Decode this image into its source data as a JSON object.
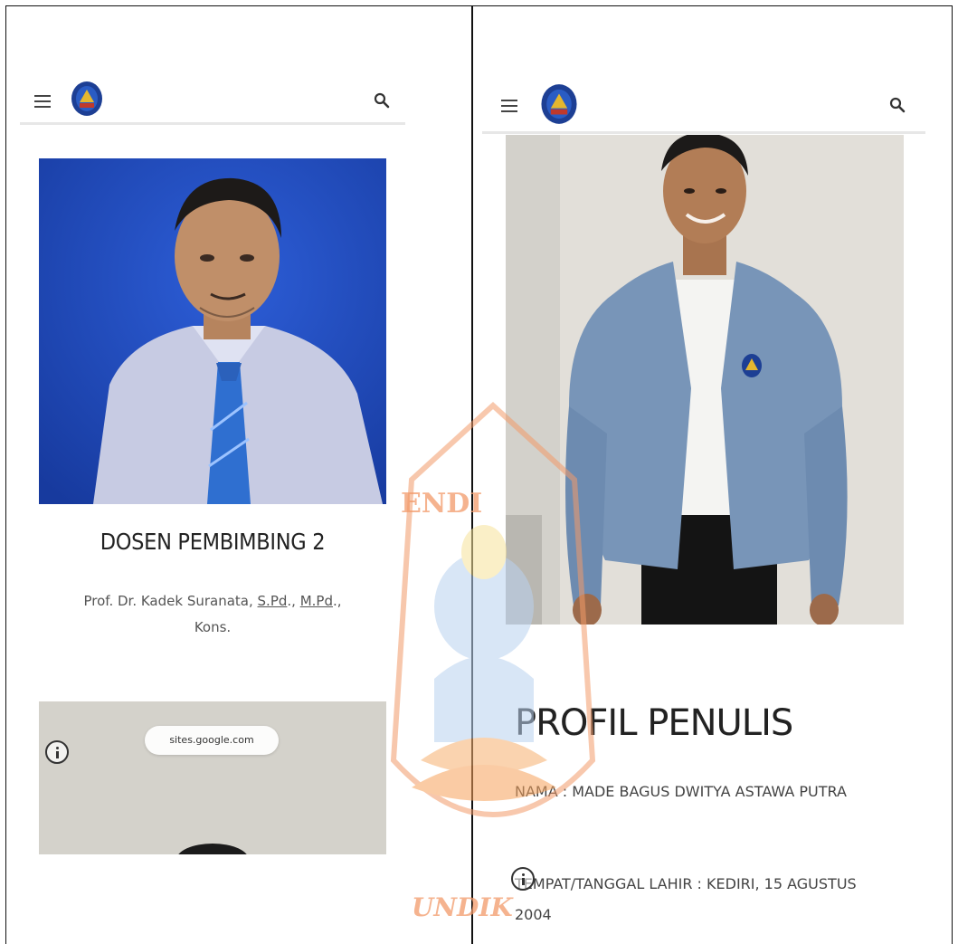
{
  "left_phone": {
    "section_title": "DOSEN PEMBIMBING 2",
    "name_part1": "Prof. Dr. Kadek Suranata, ",
    "degree1": "S.Pd",
    "sep1": "., ",
    "degree2": "M.Pd",
    "sep2": "., ",
    "name_part2": "Kons.",
    "url_pill": "sites.google.com"
  },
  "right_phone": {
    "section_title": "PROFIL PENULIS",
    "name_line": "NAMA : MADE BAGUS DWITYA ASTAWA PUTRA",
    "birth_line": "TEMPAT/TANGGAL LAHIR : KEDIRI, 15 AGUSTUS 2004"
  },
  "watermark": {
    "top_text": "ENDI",
    "bottom_text": "UNDIK"
  },
  "icons": {
    "menu": "hamburger-menu-icon",
    "search": "search-icon",
    "logo": "university-logo-icon",
    "info": "info-icon"
  },
  "colors": {
    "photo_bg_left": "#1f45b3",
    "photo_bg_right": "#dcd9d3",
    "watermark": "#f29a6a",
    "logo_blue": "#1d3f94",
    "logo_gold": "#e4b72f"
  }
}
